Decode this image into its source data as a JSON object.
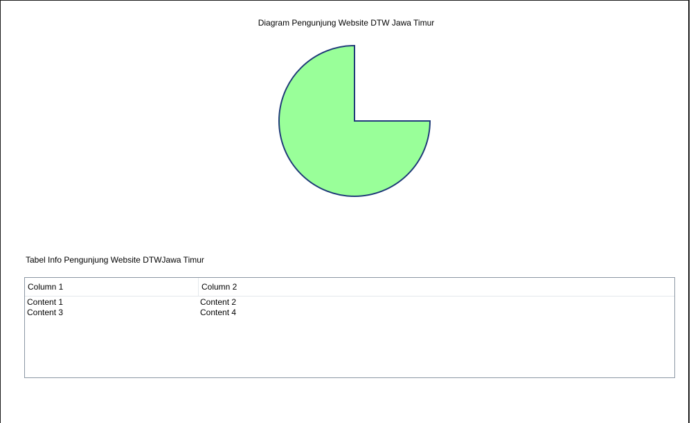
{
  "chart_data": {
    "type": "pie",
    "title": "Diagram Pengunjung Website DTW Jawa Timur",
    "slices": [
      {
        "label": "",
        "value": 75
      }
    ],
    "total": 100,
    "fill_color": "#99ff99",
    "stroke_color": "#1f3a78"
  },
  "table": {
    "title": "Tabel Info Pengunjung Website DTWJawa Timur",
    "columns": [
      "Column 1",
      "Column 2"
    ],
    "rows": [
      [
        "Content 1",
        "Content 2"
      ],
      [
        "Content 3",
        "Content 4"
      ]
    ]
  }
}
